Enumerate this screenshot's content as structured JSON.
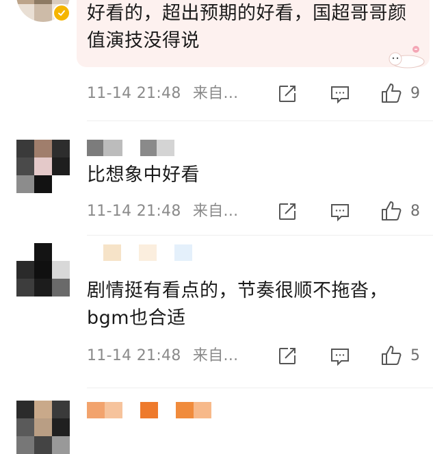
{
  "colors": {
    "text": "#1a1a1a",
    "meta": "#8a8a8a",
    "bubble": "#fdf1ef",
    "verified": "#f5b500"
  },
  "comments": [
    {
      "text": "好看的，超出预期的好看，国超哥哥颜值演技没得说",
      "time": "11-14 21:48",
      "source": "来自...",
      "likes": "9",
      "verified": true
    },
    {
      "text": "比想象中好看",
      "time": "11-14 21:48",
      "source": "来自...",
      "likes": "8"
    },
    {
      "text": "剧情挺有看点的，节奏很顺不拖沓，bgm也合适",
      "time": "11-14 21:48",
      "source": "来自...",
      "likes": "5"
    }
  ],
  "icons": {
    "share": "share-icon",
    "comment": "comment-icon",
    "like": "thumbs-up-icon",
    "verified": "verified-badge-icon",
    "sticker": "cat-sticker-icon"
  }
}
